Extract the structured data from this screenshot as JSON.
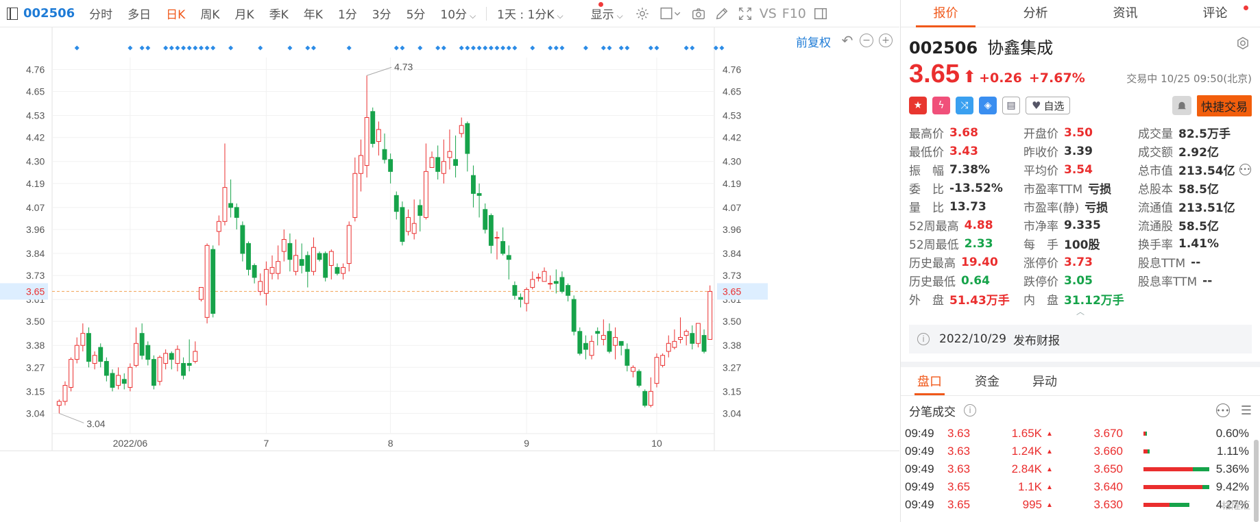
{
  "toolbar": {
    "code": "002506",
    "items": [
      "分时",
      "多日",
      "日K",
      "周K",
      "月K",
      "季K",
      "年K",
      "1分",
      "3分",
      "5分",
      "10分",
      "1天 : 1分K",
      "显示",
      "VS",
      "F10"
    ],
    "active": "日K"
  },
  "chart": {
    "adjust_label": "前复权",
    "current_price_label": "3.65",
    "max_label": "4.73",
    "min_label": "3.04"
  },
  "chart_data": {
    "type": "candlestick",
    "y_ticks": [
      4.76,
      4.65,
      4.53,
      4.42,
      4.3,
      4.19,
      4.07,
      3.96,
      3.84,
      3.73,
      3.61,
      3.5,
      3.38,
      3.27,
      3.15,
      3.04
    ],
    "ylim": [
      2.99,
      4.82
    ],
    "x_labels": [
      {
        "label": "2022/06",
        "index": 12
      },
      {
        "label": "7",
        "index": 35
      },
      {
        "label": "8",
        "index": 56
      },
      {
        "label": "9",
        "index": 79
      },
      {
        "label": "10",
        "index": 101
      }
    ],
    "reference_price": 3.65,
    "markers": [
      3,
      12,
      14,
      15,
      18,
      19,
      20,
      21,
      22,
      23,
      24,
      25,
      26,
      29,
      34,
      39,
      42,
      43,
      49,
      57,
      58,
      61,
      64,
      65,
      68,
      69,
      70,
      71,
      72,
      73,
      74,
      75,
      76,
      77,
      80,
      83,
      84,
      85,
      89,
      92,
      93,
      95,
      96,
      100,
      101,
      106,
      107,
      111,
      112
    ],
    "candles": [
      [
        3.08,
        3.1,
        3.04,
        3.11
      ],
      [
        3.1,
        3.18,
        3.08,
        3.2
      ],
      [
        3.17,
        3.31,
        3.15,
        3.32
      ],
      [
        3.31,
        3.38,
        3.29,
        3.42
      ],
      [
        3.38,
        3.44,
        3.35,
        3.49
      ],
      [
        3.44,
        3.3,
        3.27,
        3.47
      ],
      [
        3.29,
        3.33,
        3.26,
        3.35
      ],
      [
        3.37,
        3.3,
        3.27,
        3.39
      ],
      [
        3.3,
        3.23,
        3.2,
        3.32
      ],
      [
        3.24,
        3.17,
        3.15,
        3.26
      ],
      [
        3.18,
        3.23,
        3.16,
        3.27
      ],
      [
        3.21,
        3.19,
        3.16,
        3.24
      ],
      [
        3.17,
        3.27,
        3.15,
        3.29
      ],
      [
        3.28,
        3.39,
        3.27,
        3.47
      ],
      [
        3.44,
        3.33,
        3.31,
        3.49
      ],
      [
        3.38,
        3.31,
        3.28,
        3.4
      ],
      [
        3.31,
        3.18,
        3.16,
        3.33
      ],
      [
        3.2,
        3.32,
        3.18,
        3.33
      ],
      [
        3.29,
        3.34,
        3.26,
        3.36
      ],
      [
        3.34,
        3.31,
        3.26,
        3.35
      ],
      [
        3.29,
        3.36,
        3.25,
        3.38
      ],
      [
        3.29,
        3.23,
        3.21,
        3.32
      ],
      [
        3.29,
        3.28,
        3.25,
        3.41
      ],
      [
        3.3,
        3.35,
        3.29,
        3.4
      ],
      [
        3.61,
        3.67,
        3.6,
        3.67
      ],
      [
        3.52,
        3.88,
        3.49,
        3.89
      ],
      [
        3.86,
        3.54,
        3.52,
        3.88
      ],
      [
        3.95,
        4.0,
        3.88,
        4.03
      ],
      [
        4.0,
        4.17,
        3.98,
        4.39
      ],
      [
        4.09,
        4.07,
        4.02,
        4.21
      ],
      [
        4.07,
        4.02,
        3.96,
        4.09
      ],
      [
        3.98,
        3.84,
        3.8,
        4.0
      ],
      [
        3.89,
        3.76,
        3.73,
        3.9
      ],
      [
        3.78,
        3.72,
        3.69,
        3.79
      ],
      [
        3.65,
        3.7,
        3.63,
        3.74
      ],
      [
        3.64,
        3.76,
        3.58,
        3.8
      ],
      [
        3.74,
        3.77,
        3.71,
        3.83
      ],
      [
        3.74,
        3.8,
        3.71,
        3.88
      ],
      [
        3.85,
        3.91,
        3.8,
        3.96
      ],
      [
        3.89,
        3.81,
        3.75,
        3.94
      ],
      [
        3.75,
        3.83,
        3.73,
        3.91
      ],
      [
        3.81,
        3.78,
        3.74,
        3.89
      ],
      [
        3.83,
        3.75,
        3.67,
        3.85
      ],
      [
        3.75,
        3.87,
        3.73,
        3.92
      ],
      [
        3.84,
        3.81,
        3.8,
        3.85
      ],
      [
        3.84,
        3.72,
        3.7,
        3.85
      ],
      [
        3.78,
        3.85,
        3.71,
        3.86
      ],
      [
        3.77,
        3.74,
        3.73,
        3.79
      ],
      [
        3.74,
        3.77,
        3.71,
        3.79
      ],
      [
        3.79,
        3.98,
        3.75,
        4.0
      ],
      [
        4.02,
        4.24,
        4.0,
        4.32
      ],
      [
        4.24,
        4.33,
        4.15,
        4.41
      ],
      [
        4.28,
        4.52,
        4.22,
        4.73
      ],
      [
        4.55,
        4.39,
        4.37,
        4.57
      ],
      [
        4.4,
        4.46,
        4.33,
        4.5
      ],
      [
        4.36,
        4.31,
        4.29,
        4.44
      ],
      [
        4.31,
        4.25,
        4.19,
        4.34
      ],
      [
        4.13,
        4.05,
        4.01,
        4.15
      ],
      [
        4.07,
        3.9,
        3.88,
        4.1
      ],
      [
        3.95,
        4.02,
        3.93,
        4.06
      ],
      [
        3.94,
        3.99,
        3.91,
        4.11
      ],
      [
        4.08,
        4.03,
        3.95,
        4.11
      ],
      [
        4.02,
        4.25,
        4.01,
        4.39
      ],
      [
        4.27,
        4.32,
        4.27,
        4.35
      ],
      [
        4.32,
        4.25,
        4.21,
        4.38
      ],
      [
        4.24,
        4.3,
        4.19,
        4.41
      ],
      [
        4.32,
        4.35,
        4.26,
        4.46
      ],
      [
        4.31,
        4.28,
        4.22,
        4.43
      ],
      [
        4.44,
        4.48,
        4.42,
        4.52
      ],
      [
        4.49,
        4.34,
        4.25,
        4.5
      ],
      [
        4.23,
        4.14,
        4.07,
        4.28
      ],
      [
        4.14,
        4.13,
        4.02,
        4.19
      ],
      [
        4.06,
        3.96,
        3.94,
        4.09
      ],
      [
        4.03,
        3.88,
        3.84,
        4.04
      ],
      [
        3.92,
        3.92,
        3.81,
        3.95
      ],
      [
        3.9,
        3.84,
        3.83,
        3.97
      ],
      [
        3.83,
        3.81,
        3.71,
        3.88
      ],
      [
        3.68,
        3.63,
        3.61,
        3.7
      ],
      [
        3.62,
        3.61,
        3.57,
        3.64
      ],
      [
        3.59,
        3.66,
        3.55,
        3.67
      ],
      [
        3.67,
        3.71,
        3.66,
        3.75
      ],
      [
        3.72,
        3.72,
        3.7,
        3.74
      ],
      [
        3.7,
        3.75,
        3.7,
        3.77
      ],
      [
        3.69,
        3.69,
        3.66,
        3.73
      ],
      [
        3.7,
        3.69,
        3.64,
        3.76
      ],
      [
        3.72,
        3.65,
        3.64,
        3.75
      ],
      [
        3.68,
        3.63,
        3.6,
        3.69
      ],
      [
        3.61,
        3.45,
        3.43,
        3.63
      ],
      [
        3.45,
        3.34,
        3.33,
        3.47
      ],
      [
        3.39,
        3.36,
        3.31,
        3.43
      ],
      [
        3.33,
        3.4,
        3.31,
        3.43
      ],
      [
        3.45,
        3.44,
        3.38,
        3.47
      ],
      [
        3.41,
        3.43,
        3.38,
        3.51
      ],
      [
        3.45,
        3.35,
        3.34,
        3.49
      ],
      [
        3.38,
        3.42,
        3.31,
        3.47
      ],
      [
        3.4,
        3.38,
        3.33,
        3.4
      ],
      [
        3.36,
        3.28,
        3.25,
        3.39
      ],
      [
        3.25,
        3.27,
        3.22,
        3.28
      ],
      [
        3.25,
        3.18,
        3.17,
        3.26
      ],
      [
        3.15,
        3.08,
        3.07,
        3.16
      ],
      [
        3.08,
        3.15,
        3.07,
        3.22
      ],
      [
        3.19,
        3.32,
        3.17,
        3.34
      ],
      [
        3.28,
        3.33,
        3.27,
        3.34
      ],
      [
        3.35,
        3.39,
        3.32,
        3.43
      ],
      [
        3.37,
        3.4,
        3.36,
        3.46
      ],
      [
        3.41,
        3.42,
        3.39,
        3.52
      ],
      [
        3.43,
        3.45,
        3.38,
        3.46
      ],
      [
        3.44,
        3.39,
        3.36,
        3.48
      ],
      [
        3.39,
        3.49,
        3.37,
        3.49
      ],
      [
        3.43,
        3.35,
        3.34,
        3.46
      ],
      [
        3.41,
        3.65,
        3.43,
        3.68
      ]
    ]
  },
  "right_panel": {
    "tabs": [
      "报价",
      "分析",
      "资讯",
      "评论"
    ],
    "active_tab": "报价",
    "code": "002506",
    "name": "协鑫集成",
    "price": "3.65",
    "change": "+0.26",
    "change_pct": "+7.67%",
    "status": "交易中 10/25 09:50(北京)",
    "watch_label": "自选",
    "quick_trade": "快捷交易",
    "stats": [
      [
        "最高价",
        "3.68",
        "red"
      ],
      [
        "开盘价",
        "3.50",
        "red"
      ],
      [
        "成交量",
        "82.5万手",
        ""
      ],
      [
        "最低价",
        "3.43",
        "red"
      ],
      [
        "昨收价",
        "3.39",
        ""
      ],
      [
        "成交额",
        "2.92亿",
        ""
      ],
      [
        "振　幅",
        "7.38%",
        ""
      ],
      [
        "平均价",
        "3.54",
        "red"
      ],
      [
        "总市值",
        "213.54亿",
        ""
      ],
      [
        "委　比",
        "-13.52%",
        ""
      ],
      [
        "市盈率TTM",
        "亏损",
        ""
      ],
      [
        "总股本",
        "58.5亿",
        ""
      ],
      [
        "量　比",
        "13.73",
        ""
      ],
      [
        "市盈率(静)",
        "亏损",
        ""
      ],
      [
        "流通值",
        "213.51亿",
        ""
      ],
      [
        "52周最高",
        "4.88",
        "red"
      ],
      [
        "市净率",
        "9.335",
        ""
      ],
      [
        "流通股",
        "58.5亿",
        ""
      ],
      [
        "52周最低",
        "2.33",
        "green"
      ],
      [
        "每　手",
        "100股",
        ""
      ],
      [
        "换手率",
        "1.41%",
        ""
      ],
      [
        "历史最高",
        "19.40",
        "red"
      ],
      [
        "涨停价",
        "3.73",
        "red"
      ],
      [
        "股息TTM",
        "--",
        ""
      ],
      [
        "历史最低",
        "0.64",
        "green"
      ],
      [
        "跌停价",
        "3.05",
        "green"
      ],
      [
        "股息率TTM",
        "--",
        ""
      ],
      [
        "外　盘",
        "51.43万手",
        "red"
      ],
      [
        "内　盘",
        "31.12万手",
        "green"
      ],
      [
        "",
        "",
        ""
      ]
    ],
    "report": {
      "date": "2022/10/29",
      "text": "发布财报"
    },
    "subtabs": [
      "盘口",
      "资金",
      "异动"
    ],
    "active_subtab": "盘口",
    "ticks_title": "分笔成交",
    "ticks": [
      {
        "time": "09:49",
        "price": "3.63",
        "vol": "1.65K",
        "level": "3.670",
        "red": 0.03,
        "green": 0.02,
        "pct": "0.60%"
      },
      {
        "time": "09:49",
        "price": "3.63",
        "vol": "1.24K",
        "level": "3.660",
        "red": 0.06,
        "green": 0.03,
        "pct": "1.11%"
      },
      {
        "time": "09:49",
        "price": "3.63",
        "vol": "2.84K",
        "level": "3.650",
        "red": 0.75,
        "green": 0.25,
        "pct": "5.36%"
      },
      {
        "time": "09:49",
        "price": "3.65",
        "vol": "1.1K",
        "level": "3.640",
        "red": 0.9,
        "green": 0.1,
        "pct": "9.42%"
      },
      {
        "time": "09:49",
        "price": "3.65",
        "vol": "995",
        "level": "3.630",
        "red": 0.4,
        "green": 0.3,
        "pct": "4.27%"
      }
    ],
    "watermark": "格隆汇"
  }
}
